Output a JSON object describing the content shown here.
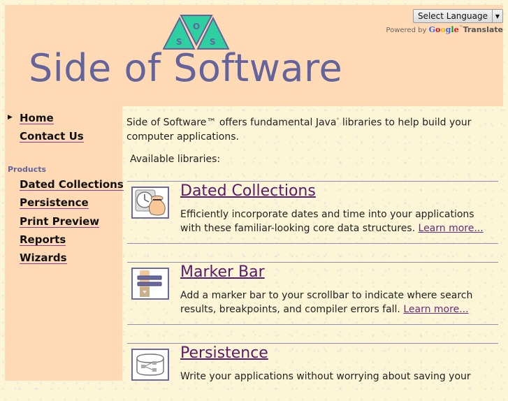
{
  "header": {
    "logo_letters": [
      "S",
      "O",
      "S"
    ],
    "title": "Side of Software",
    "translate": {
      "select_label": "Select Language",
      "powered_by": "Powered by",
      "google": "Google",
      "tm": "™",
      "translate": "Translate"
    }
  },
  "sidebar": {
    "nav": [
      {
        "label": "Home",
        "current": true
      },
      {
        "label": "Contact Us"
      }
    ],
    "products_heading": "Products",
    "products": [
      {
        "label": "Dated Collections"
      },
      {
        "label": "Persistence"
      },
      {
        "label": "Print Preview"
      },
      {
        "label": "Reports"
      },
      {
        "label": "Wizards"
      }
    ]
  },
  "main": {
    "intro_before": "Side of Software™ offers fundamental Java",
    "intro_sup": "*",
    "intro_after": " libraries to help build your computer applications.",
    "available_label": "Available libraries:",
    "learn_more": "Learn more...",
    "libraries": [
      {
        "title": "Dated Collections",
        "icon": "clock-bag-icon",
        "description": "Efficiently incorporate dates and time into your applications with these familiar-looking core data structures."
      },
      {
        "title": "Marker Bar",
        "icon": "marker-bar-icon",
        "description": "Add a marker bar to your scrollbar to indicate where search results, breakpoints, and compiler errors fall."
      },
      {
        "title": "Persistence",
        "icon": "database-icon",
        "description": "Write your applications without worrying about saving your"
      }
    ]
  },
  "colors": {
    "header_bg": "#ffdab5",
    "title_color": "#64649c",
    "logo_green": "#2ecfa0",
    "link_visited": "#5a1a6a",
    "rule": "#8e8eb8"
  }
}
